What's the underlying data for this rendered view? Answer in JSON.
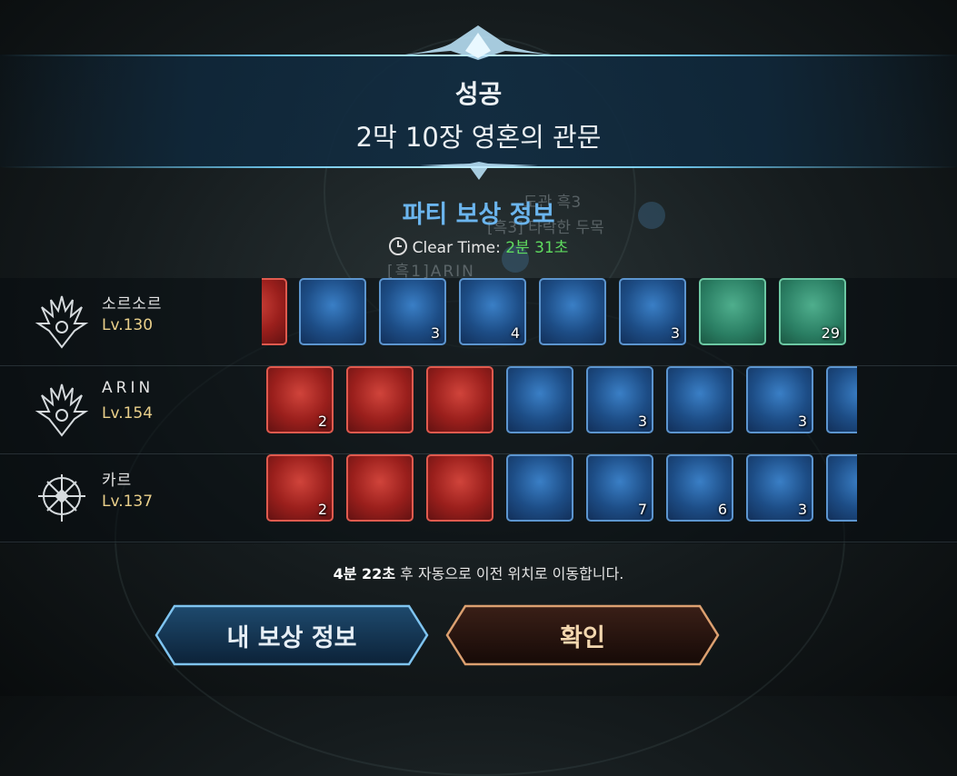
{
  "header": {
    "status": "성공",
    "stage": "2막 10장 영혼의 관문"
  },
  "reward": {
    "title": "파티 보상 정보",
    "clear_label": "Clear Time:",
    "clear_time": "2분 31초"
  },
  "background_text": {
    "line1": "도관 흑3",
    "line2": "[흑3] 타락한 두목",
    "line3": "[흑1]ARIN"
  },
  "players": [
    {
      "name": "소르소르",
      "level": "Lv.130",
      "class_icon": "spiked-crest-icon",
      "items": [
        {
          "icon": "green-orb-icon",
          "frame": "red",
          "count": ""
        },
        {
          "icon": "purple-chest-icon",
          "frame": "blue",
          "count": ""
        },
        {
          "icon": "orange-fruit-icon",
          "frame": "blue",
          "count": "3"
        },
        {
          "icon": "green-bean-icon",
          "frame": "blue",
          "count": "4"
        },
        {
          "icon": "red-chest-icon",
          "frame": "blue",
          "count": ""
        },
        {
          "icon": "green-orb-icon",
          "frame": "blue",
          "count": "3"
        },
        {
          "icon": "book-icon",
          "frame": "teal",
          "count": ""
        },
        {
          "icon": "scroll-icon",
          "frame": "teal",
          "count": "29"
        }
      ]
    },
    {
      "name": "ARIN",
      "level": "Lv.154",
      "class_icon": "spiked-crest-icon",
      "items": [
        {
          "icon": "wooden-chest-icon",
          "frame": "red",
          "count": "2"
        },
        {
          "icon": "green-orb-icon",
          "frame": "red",
          "count": ""
        },
        {
          "icon": "orange-fruit-icon",
          "frame": "red",
          "count": ""
        },
        {
          "icon": "purple-chest-icon",
          "frame": "blue",
          "count": ""
        },
        {
          "icon": "green-bean-icon",
          "frame": "blue",
          "count": "3"
        },
        {
          "icon": "red-chest-icon",
          "frame": "blue",
          "count": ""
        },
        {
          "icon": "orange-fruit-icon",
          "frame": "blue",
          "count": "3"
        },
        {
          "icon": "green-orb-icon",
          "frame": "blue",
          "count": ""
        }
      ]
    },
    {
      "name": "카르",
      "level": "Lv.137",
      "class_icon": "crossbow-crest-icon",
      "items": [
        {
          "icon": "wooden-chest-icon",
          "frame": "red",
          "count": "2"
        },
        {
          "icon": "green-orb-icon",
          "frame": "red",
          "count": ""
        },
        {
          "icon": "orange-fruit-icon",
          "frame": "red",
          "count": ""
        },
        {
          "icon": "purple-chest-icon",
          "frame": "blue",
          "count": ""
        },
        {
          "icon": "root-creature-icon",
          "frame": "blue",
          "count": "7"
        },
        {
          "icon": "lantern-icon",
          "frame": "blue",
          "count": "6"
        },
        {
          "icon": "green-bean-icon",
          "frame": "blue",
          "count": "3"
        },
        {
          "icon": "red-chest-icon",
          "frame": "blue",
          "count": ""
        }
      ]
    }
  ],
  "footer": {
    "countdown": "4분 22초",
    "message": "후 자동으로 이전 위치로 이동합니다."
  },
  "buttons": {
    "my_reward": "내 보상 정보",
    "confirm": "확인"
  },
  "colors": {
    "accent_blue": "#6bb5ee",
    "clear_time_green": "#5fdc5f",
    "level_gold": "#e9cf8a"
  }
}
